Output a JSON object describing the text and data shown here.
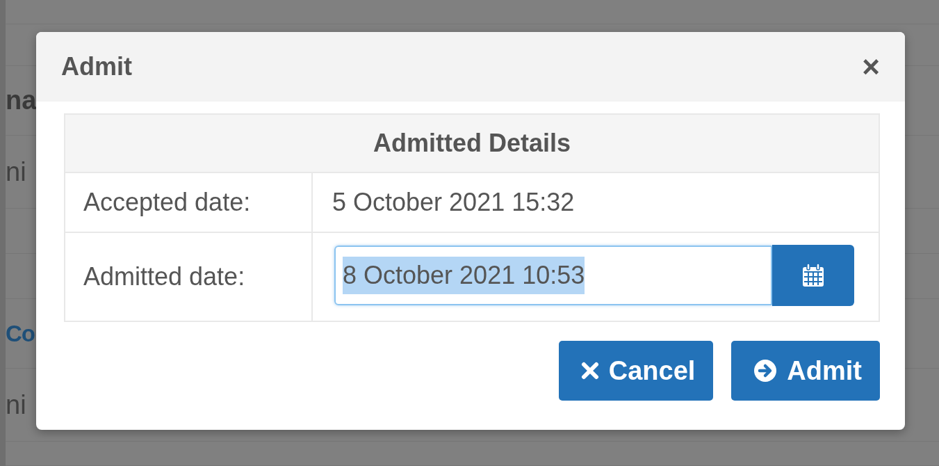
{
  "background": {
    "fragments": [
      {
        "text": "na",
        "kind": "heading"
      },
      {
        "text": "ni",
        "kind": "text"
      },
      {
        "text": "Co",
        "kind": "link"
      },
      {
        "text": "ni",
        "kind": "text"
      }
    ]
  },
  "modal": {
    "title": "Admit",
    "close": "×",
    "table": {
      "heading": "Admitted Details",
      "rows": [
        {
          "label": "Accepted date:",
          "kind": "text",
          "value": "5 October 2021 15:32"
        },
        {
          "label": "Admitted date:",
          "kind": "date-field",
          "value": "8 October 2021 10:53",
          "focused": true,
          "text_selected": true
        }
      ]
    },
    "buttons": [
      {
        "label": "Cancel",
        "kind": "cancel"
      },
      {
        "label": "Admit",
        "kind": "submit"
      }
    ]
  }
}
